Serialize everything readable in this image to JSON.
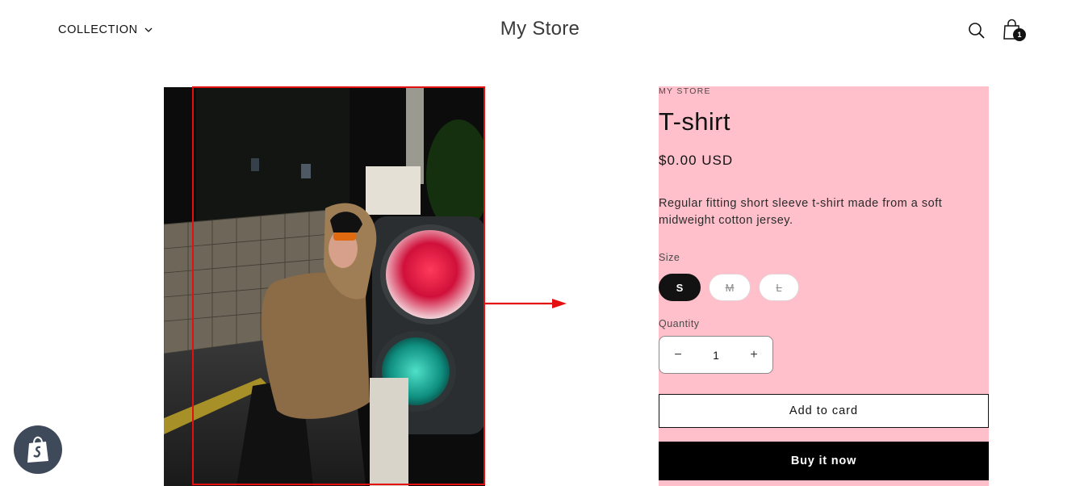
{
  "header": {
    "nav_collection_label": "COLLECTION",
    "store_name": "My Store",
    "cart_count": "1",
    "icons": [
      "chevron-down-icon",
      "search-icon",
      "cart-icon"
    ]
  },
  "product": {
    "vendor": "MY STORE",
    "title": "T-shirt",
    "price": "$0.00 USD",
    "description": "Regular fitting short sleeve t-shirt made from a soft midweight cotton jersey.",
    "size_label": "Size",
    "sizes": [
      {
        "label": "S",
        "selected": true,
        "available": true
      },
      {
        "label": "M",
        "selected": false,
        "available": false
      },
      {
        "label": "L",
        "selected": false,
        "available": false
      }
    ],
    "quantity_label": "Quantity",
    "quantity_value": "1",
    "quantity_decrease": "−",
    "quantity_increase": "+",
    "add_to_cart_label": "Add to card",
    "buy_now_label": "Buy it now"
  },
  "colors": {
    "info_background": "#ffc0cb",
    "highlight_box": "#e41010",
    "buy_button": "#000000",
    "badge": "#3e4a5a"
  }
}
